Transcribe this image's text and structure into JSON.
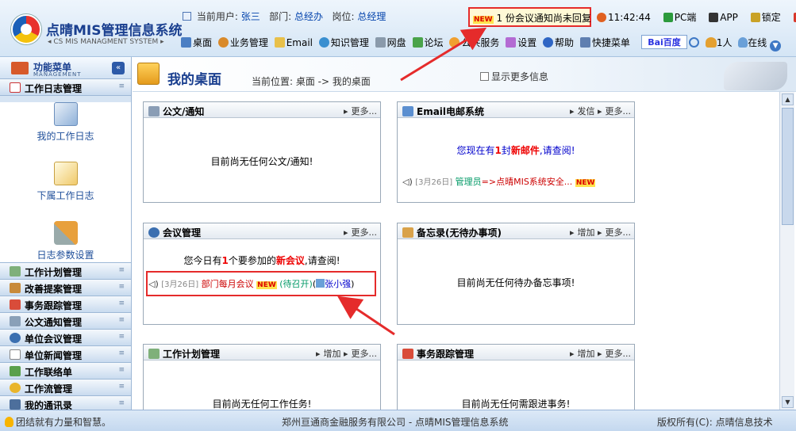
{
  "header": {
    "title": "点晴MIS管理信息系统",
    "subtitle": "CS MIS MANAGMENT SYSTEM",
    "user_label": "当前用户:",
    "user": "张三",
    "dept_label": "部门:",
    "dept": "总经办",
    "post_label": "岗位:",
    "post": "总经理",
    "notice_tag": "NEW",
    "notice_text": "1 份会议通知尚未回复",
    "time": "11:42:44",
    "pc": "PC端",
    "app": "APP",
    "lock": "锁定",
    "logout": "退出"
  },
  "nav": {
    "items": [
      "桌面",
      "业务管理",
      "Email",
      "知识管理",
      "网盘",
      "论坛",
      "公共服务",
      "设置",
      "帮助",
      "快捷菜单"
    ],
    "baidu": "Bai百度",
    "online_count": "1人",
    "online": "在线"
  },
  "sidebar": {
    "title": "功能菜单",
    "subtitle": "MANAGEMENT",
    "open_section": "工作日志管理",
    "tools": [
      "我的工作日志",
      "下属工作日志",
      "日志参数设置"
    ],
    "sections": [
      "工作计划管理",
      "改善提案管理",
      "事务跟踪管理",
      "公文通知管理",
      "单位会议管理",
      "单位新闻管理",
      "工作联络单",
      "工作流管理",
      "我的通讯录"
    ]
  },
  "main": {
    "title": "我的桌面",
    "breadcrumb": "当前位置: 桌面 -> 我的桌面",
    "more_info": "显示更多信息"
  },
  "panels": {
    "doc": {
      "title": "公文/通知",
      "more": "更多...",
      "empty": "目前尚无任何公文/通知!"
    },
    "email": {
      "title": "Email电邮系统",
      "send": "发信",
      "more": "更多...",
      "msg_pre": "您现在有",
      "msg_count": "1",
      "msg_mid": "封",
      "msg_new": "新邮件",
      "msg_post": ",请查阅!",
      "row_date": "[3月26日]",
      "row_sender": "管理员",
      "row_arrow": "=>",
      "row_subject": "点晴MIS系统安全...",
      "row_tag": "NEW"
    },
    "meeting": {
      "title": "会议管理",
      "more": "更多...",
      "msg_pre": "您今日有",
      "msg_count": "1",
      "msg_mid": "个要参加的",
      "msg_new": "新会议",
      "msg_post": ",请查阅!",
      "row_date": "[3月26日]",
      "row_subject": "部门每月会议",
      "row_tag": "NEW",
      "row_status": "(待召开)",
      "row_person": "张小强"
    },
    "memo": {
      "title": "备忘录(无待办事项)",
      "add": "增加",
      "more": "更多...",
      "empty": "目前尚无任何待办备忘事项!"
    },
    "plan": {
      "title": "工作计划管理",
      "add": "增加",
      "more": "更多...",
      "empty": "目前尚无任何工作任务!"
    },
    "track": {
      "title": "事务跟踪管理",
      "add": "增加",
      "more": "更多...",
      "empty": "目前尚无任何需跟进事务!"
    }
  },
  "footer": {
    "motto": "团结就有力量和智慧。",
    "company": "郑州亘通商金融服务有限公司 - 点晴MIS管理信息系统",
    "copyright": "版权所有(C): 点晴信息技术"
  },
  "colors": {
    "accent": "#1a3f8f",
    "alert": "#e52b2b",
    "sidebar": "#d6e4f3"
  }
}
